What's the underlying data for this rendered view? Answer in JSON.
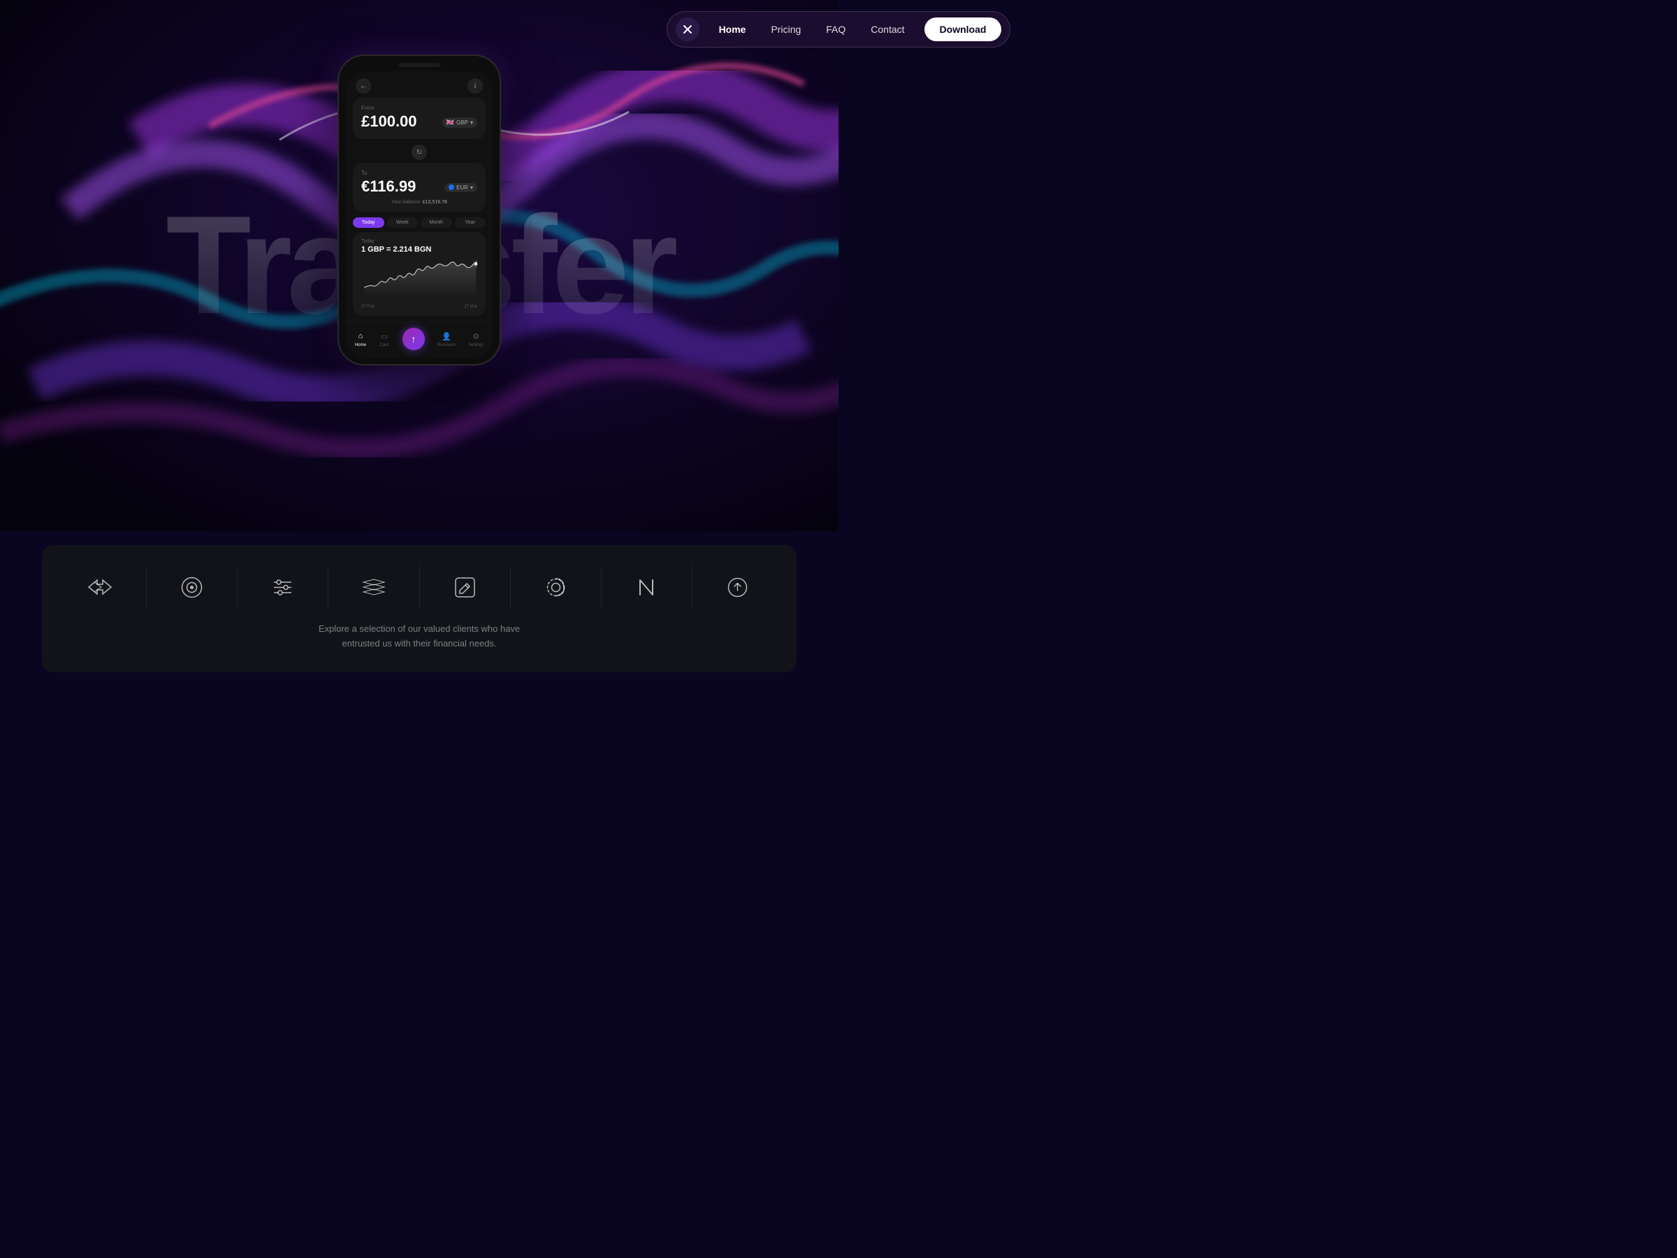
{
  "nav": {
    "close_label": "×",
    "links": [
      {
        "label": "Home",
        "active": true
      },
      {
        "label": "Pricing",
        "active": false
      },
      {
        "label": "FAQ",
        "active": false
      },
      {
        "label": "Contact",
        "active": false
      }
    ],
    "download_label": "Download"
  },
  "hero": {
    "title": "Transfer"
  },
  "phone": {
    "from_label": "From",
    "from_amount": "£100.00",
    "from_currency": "GBP",
    "to_label": "To",
    "to_amount": "€116.99",
    "to_currency": "EUR",
    "balance_label": "Your balance:",
    "balance_amount": "£13,519.78",
    "time_tabs": [
      "Today",
      "Week",
      "Month",
      "Year"
    ],
    "active_tab": "Today",
    "chart_title": "Today",
    "chart_rate": "1 GBP = 2.214 BGN",
    "date_start": "27 Feb",
    "date_end": "27 Mar",
    "bottom_nav": [
      {
        "label": "Home",
        "active": true
      },
      {
        "label": "Card",
        "active": false
      },
      {
        "label": "",
        "active": false,
        "center": true
      },
      {
        "label": "Receivers",
        "active": false
      },
      {
        "label": "Settings",
        "active": false
      }
    ]
  },
  "logos_section": {
    "description_line1": "Explore a selection of our valued clients who have",
    "description_line2": "entrusted us with their financial needs.",
    "logos": [
      {
        "name": "double-arrow",
        "symbol": "❯❯"
      },
      {
        "name": "circle-dot",
        "symbol": "◉"
      },
      {
        "name": "filter",
        "symbol": "⚡"
      },
      {
        "name": "layers",
        "symbol": "≋"
      },
      {
        "name": "edit-box",
        "symbol": "✎"
      },
      {
        "name": "spiral",
        "symbol": "⊛"
      },
      {
        "name": "letter-n",
        "symbol": "ℕ"
      },
      {
        "name": "upload",
        "symbol": "⬆"
      }
    ]
  }
}
